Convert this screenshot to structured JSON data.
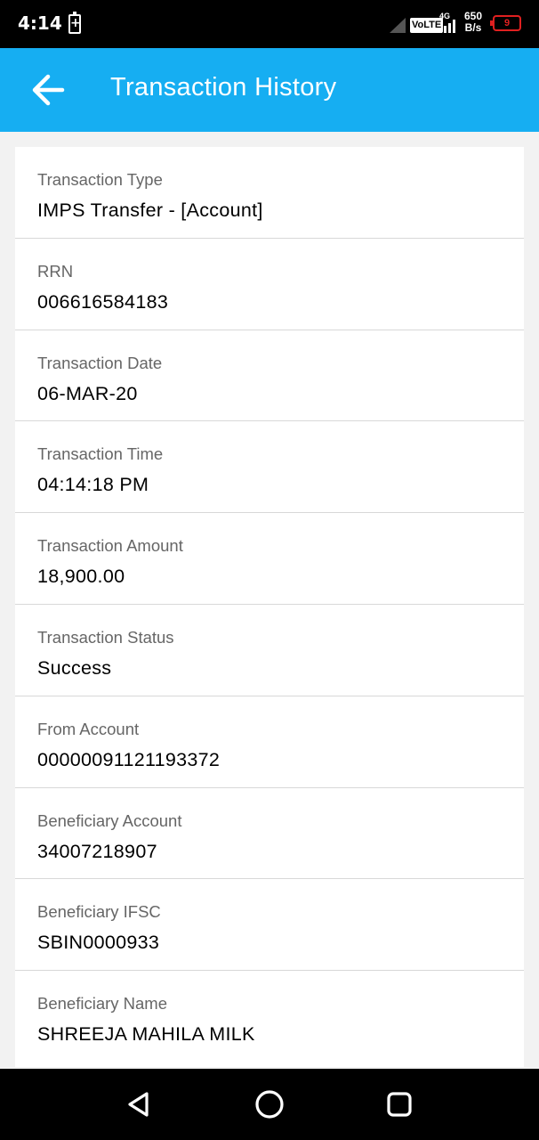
{
  "status_bar": {
    "time": "4:14",
    "network_type": "4G",
    "volte": "VoLTE",
    "speed_value": "650",
    "speed_unit": "B/s",
    "battery_level": "9"
  },
  "app_bar": {
    "title": "Transaction History",
    "back_icon": "arrow-left-icon"
  },
  "details": [
    {
      "label": "Transaction Type",
      "value": "IMPS Transfer - [Account]"
    },
    {
      "label": "RRN",
      "value": "006616584183"
    },
    {
      "label": "Transaction Date",
      "value": "06-MAR-20"
    },
    {
      "label": "Transaction Time",
      "value": "04:14:18 PM"
    },
    {
      "label": "Transaction Amount",
      "value": "18,900.00"
    },
    {
      "label": "Transaction Status",
      "value": "Success"
    },
    {
      "label": "From Account",
      "value": "00000091121193372"
    },
    {
      "label": "Beneficiary Account",
      "value": "34007218907"
    },
    {
      "label": "Beneficiary IFSC",
      "value": "SBIN0000933"
    },
    {
      "label": "Beneficiary Name",
      "value": "SHREEJA MAHILA MILK"
    }
  ],
  "nav_bar": {
    "back_icon": "triangle-back-icon",
    "home_icon": "circle-home-icon",
    "recents_icon": "square-recents-icon"
  },
  "colors": {
    "app_bar": "#16aef2",
    "battery_low": "#e02020"
  }
}
